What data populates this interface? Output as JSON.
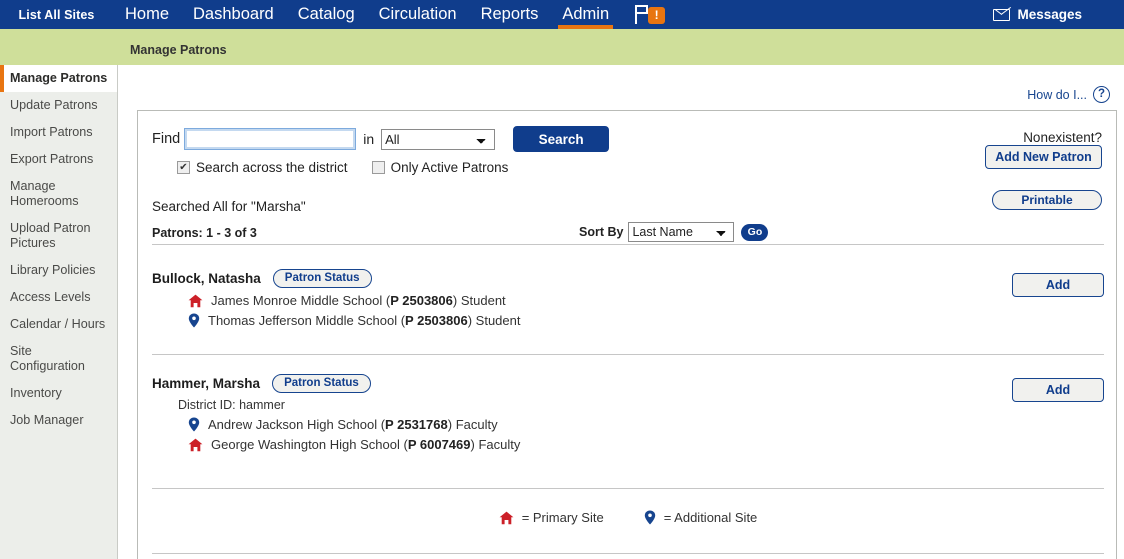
{
  "topnav": {
    "site_selector": "List All Sites",
    "items": [
      {
        "label": "Home",
        "active": false
      },
      {
        "label": "Dashboard",
        "active": false
      },
      {
        "label": "Catalog",
        "active": false
      },
      {
        "label": "Circulation",
        "active": false
      },
      {
        "label": "Reports",
        "active": false
      },
      {
        "label": "Admin",
        "active": true
      }
    ],
    "flag_badge": "!",
    "messages_label": "Messages",
    "bar_color": "#103d8c",
    "accent_color": "#e87511"
  },
  "breadcrumb": "Manage Patrons",
  "breadband_color": "#cfdf9a",
  "sidebar": {
    "items": [
      {
        "label": "Manage Patrons",
        "active": true
      },
      {
        "label": "Update Patrons",
        "active": false
      },
      {
        "label": "Import Patrons",
        "active": false
      },
      {
        "label": "Export Patrons",
        "active": false
      },
      {
        "label": "Manage Homerooms",
        "active": false
      },
      {
        "label": "Upload Patron Pictures",
        "active": false
      },
      {
        "label": "Library Policies",
        "active": false
      },
      {
        "label": "Access Levels",
        "active": false
      },
      {
        "label": "Calendar / Hours",
        "active": false
      },
      {
        "label": "Site Configuration",
        "active": false
      },
      {
        "label": "Inventory",
        "active": false
      },
      {
        "label": "Job Manager",
        "active": false
      }
    ]
  },
  "help": {
    "label": "How do I...",
    "mark": "?"
  },
  "search": {
    "find_label": "Find",
    "find_value": "",
    "find_placeholder": "",
    "in_label": "in",
    "scope_value": "All",
    "scope_options": [
      "All"
    ],
    "search_button": "Search",
    "checkbox_district_label": "Search across the district",
    "checkbox_district_checked": true,
    "checkbox_active_label": "Only Active Patrons",
    "checkbox_active_checked": false,
    "searched_text": "Searched All for \"Marsha\"",
    "patron_count": "Patrons: 1 - 3 of 3",
    "sort_label": "Sort By",
    "sort_value": "Last Name",
    "sort_options": [
      "Last Name"
    ],
    "go_button": "Go"
  },
  "actions": {
    "nonexistent_label": "Nonexistent?",
    "add_new_patron": "Add New Patron",
    "printable": "Printable",
    "add_button": "Add",
    "patron_status": "Patron Status"
  },
  "patrons": [
    {
      "name": "Bullock, Natasha",
      "district_id": null,
      "sites": [
        {
          "type": "primary",
          "school": "James Monroe Middle School",
          "prefix": "P",
          "number": "2503806",
          "role": "Student"
        },
        {
          "type": "additional",
          "school": "Thomas Jefferson Middle School",
          "prefix": "P",
          "number": "2503806",
          "role": "Student"
        }
      ]
    },
    {
      "name": "Hammer, Marsha",
      "district_id": "District ID: hammer",
      "sites": [
        {
          "type": "additional",
          "school": "Andrew Jackson High School",
          "prefix": "P",
          "number": "2531768",
          "role": "Faculty"
        },
        {
          "type": "primary",
          "school": "George Washington High School",
          "prefix": "P",
          "number": "6007469",
          "role": "Faculty"
        }
      ]
    }
  ],
  "legend": {
    "primary": "= Primary Site",
    "additional": "= Additional Site",
    "primary_color": "#cc2028",
    "additional_color": "#17458f"
  }
}
